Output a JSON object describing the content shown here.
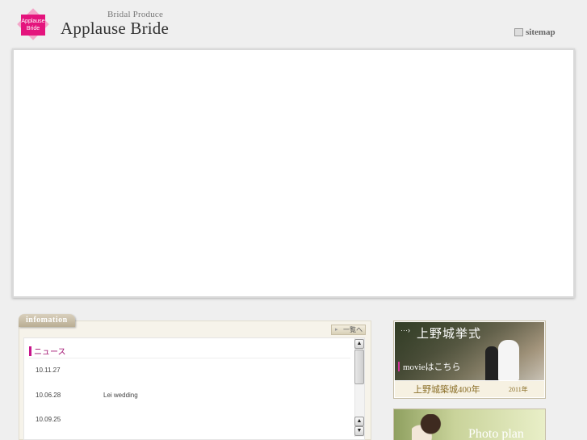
{
  "header": {
    "logo_text": "Applause Bride",
    "brand_sub": "Bridal Produce",
    "brand_title": "Applause Bride",
    "sitemap_label": "sitemap"
  },
  "info": {
    "tab_label": "infomation",
    "list_button_label": "一覧へ",
    "news_heading": "ニュース",
    "news": [
      {
        "date": "10.11.27",
        "title": ""
      },
      {
        "date": "10.06.28",
        "title": "Lei wedding"
      },
      {
        "date": "10.09.25",
        "title": ""
      }
    ]
  },
  "banners": {
    "ueno_heading": "上野城挙式",
    "ueno_movie": "movieはこちら",
    "ueno_footer_main": "上野城築城400年",
    "ueno_footer_year": "2011年",
    "photo_plan_label": "Photo plan"
  },
  "colors": {
    "accent_pink": "#e4147d",
    "news_accent": "#c8168c",
    "page_bg": "#efefef"
  }
}
